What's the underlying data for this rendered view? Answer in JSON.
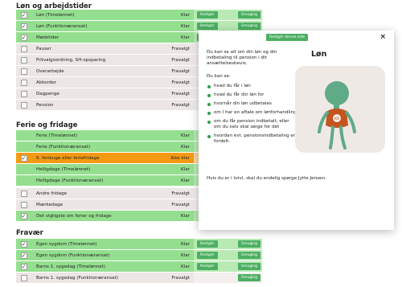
{
  "sections": {
    "lon_title": "Løn og arbejdstider",
    "ferie_title": "Ferie og fridage",
    "fravaer_title": "Fravær"
  },
  "buttons": {
    "rediger": "Redigér",
    "smugkig": "Smugkig",
    "edit_page": "Redigér denne side"
  },
  "lon_rows": [
    {
      "name": "Løn (Timelønnet)",
      "status": "Klar",
      "checked": true
    },
    {
      "name": "Løn (Funktionæransat)",
      "status": "Klar",
      "checked": true
    },
    {
      "name": "Mødetider",
      "status": "Klar",
      "checked": true
    },
    {
      "name": "Pauser",
      "status": "Fravalgt",
      "checked": false
    },
    {
      "name": "Fritvalgsordning, SH-opsparing",
      "status": "Fravalgt",
      "checked": false
    },
    {
      "name": "Overarbejde",
      "status": "Fravalgt",
      "checked": false
    },
    {
      "name": "Akkorder",
      "status": "Fravalgt",
      "checked": false
    },
    {
      "name": "Dagpenge",
      "status": "Fravalgt",
      "checked": false
    },
    {
      "name": "Pension",
      "status": "Fravalgt",
      "checked": false
    }
  ],
  "ferie_rows": [
    {
      "name": "Ferie (Timelønnet)",
      "status": "Klar",
      "checked": false
    },
    {
      "name": "Ferie (Funktionæransat)",
      "status": "Klar",
      "checked": false
    },
    {
      "name": "6. ferieuge eller feriefridage",
      "status": "Ikke klar",
      "checked": true
    },
    {
      "name": "Helligdage (Timelønnet)",
      "status": "Klar",
      "checked": false
    },
    {
      "name": "Helligdage (Funktionæransat)",
      "status": "Klar",
      "checked": false
    },
    {
      "name": "Andre fridage",
      "status": "Fravalgt",
      "checked": false
    },
    {
      "name": "Mærkedage",
      "status": "Fravalgt",
      "checked": false
    },
    {
      "name": "Det vigtigste om ferier og fridage",
      "status": "Klar",
      "checked": true
    }
  ],
  "fravaer_rows": [
    {
      "name": "Egen sygdom (Timelønnet)",
      "status": "Klar",
      "checked": true
    },
    {
      "name": "Egen sygdom (Funktionæransat)",
      "status": "Klar",
      "checked": true
    },
    {
      "name": "Barns 1. sygedag (Timelønnet)",
      "status": "Klar",
      "checked": true
    },
    {
      "name": "Barns 1. sygedag (Funktionæransat)",
      "status": "Fravalgt",
      "checked": false
    }
  ],
  "modal": {
    "heading": "Løn",
    "intro": "Du kan se alt om din løn og din indbetaling til pension i dit ansættelsesbevis.",
    "sub": "Du kan se:",
    "bullets": [
      "hvad du får i løn",
      "hvad du får din løn for",
      "hvornår din løn udbetales",
      "om I har en aftale om lønforhandling",
      "om du får pension indbetalt, eller om du selv skal sørge for det",
      "hvordan evt. pensionsindbetaling er fordelt."
    ],
    "outro": "Hvis du er i tvivl, skal du endelig spørge Jytte Jensen.",
    "badge_text": "KR",
    "colors": {
      "illus_bg": "#efe9e6",
      "figure": "#5faa87",
      "shirt": "#c4551f"
    }
  },
  "colors": {
    "active": "#94df8f",
    "inactive": "#ece6e4",
    "warn": "#f49a12",
    "button": "#4caf62"
  }
}
